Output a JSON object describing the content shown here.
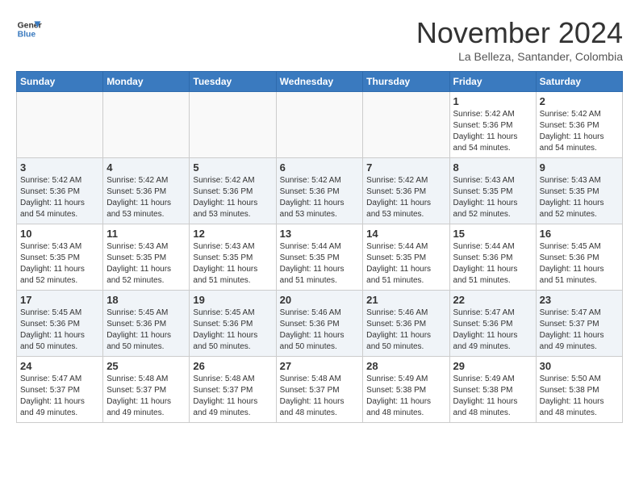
{
  "logo": {
    "line1": "General",
    "line2": "Blue"
  },
  "title": "November 2024",
  "location": "La Belleza, Santander, Colombia",
  "weekdays": [
    "Sunday",
    "Monday",
    "Tuesday",
    "Wednesday",
    "Thursday",
    "Friday",
    "Saturday"
  ],
  "weeks": [
    [
      {
        "day": "",
        "info": ""
      },
      {
        "day": "",
        "info": ""
      },
      {
        "day": "",
        "info": ""
      },
      {
        "day": "",
        "info": ""
      },
      {
        "day": "",
        "info": ""
      },
      {
        "day": "1",
        "info": "Sunrise: 5:42 AM\nSunset: 5:36 PM\nDaylight: 11 hours and 54 minutes."
      },
      {
        "day": "2",
        "info": "Sunrise: 5:42 AM\nSunset: 5:36 PM\nDaylight: 11 hours and 54 minutes."
      }
    ],
    [
      {
        "day": "3",
        "info": "Sunrise: 5:42 AM\nSunset: 5:36 PM\nDaylight: 11 hours and 54 minutes."
      },
      {
        "day": "4",
        "info": "Sunrise: 5:42 AM\nSunset: 5:36 PM\nDaylight: 11 hours and 53 minutes."
      },
      {
        "day": "5",
        "info": "Sunrise: 5:42 AM\nSunset: 5:36 PM\nDaylight: 11 hours and 53 minutes."
      },
      {
        "day": "6",
        "info": "Sunrise: 5:42 AM\nSunset: 5:36 PM\nDaylight: 11 hours and 53 minutes."
      },
      {
        "day": "7",
        "info": "Sunrise: 5:42 AM\nSunset: 5:36 PM\nDaylight: 11 hours and 53 minutes."
      },
      {
        "day": "8",
        "info": "Sunrise: 5:43 AM\nSunset: 5:35 PM\nDaylight: 11 hours and 52 minutes."
      },
      {
        "day": "9",
        "info": "Sunrise: 5:43 AM\nSunset: 5:35 PM\nDaylight: 11 hours and 52 minutes."
      }
    ],
    [
      {
        "day": "10",
        "info": "Sunrise: 5:43 AM\nSunset: 5:35 PM\nDaylight: 11 hours and 52 minutes."
      },
      {
        "day": "11",
        "info": "Sunrise: 5:43 AM\nSunset: 5:35 PM\nDaylight: 11 hours and 52 minutes."
      },
      {
        "day": "12",
        "info": "Sunrise: 5:43 AM\nSunset: 5:35 PM\nDaylight: 11 hours and 51 minutes."
      },
      {
        "day": "13",
        "info": "Sunrise: 5:44 AM\nSunset: 5:35 PM\nDaylight: 11 hours and 51 minutes."
      },
      {
        "day": "14",
        "info": "Sunrise: 5:44 AM\nSunset: 5:35 PM\nDaylight: 11 hours and 51 minutes."
      },
      {
        "day": "15",
        "info": "Sunrise: 5:44 AM\nSunset: 5:36 PM\nDaylight: 11 hours and 51 minutes."
      },
      {
        "day": "16",
        "info": "Sunrise: 5:45 AM\nSunset: 5:36 PM\nDaylight: 11 hours and 51 minutes."
      }
    ],
    [
      {
        "day": "17",
        "info": "Sunrise: 5:45 AM\nSunset: 5:36 PM\nDaylight: 11 hours and 50 minutes."
      },
      {
        "day": "18",
        "info": "Sunrise: 5:45 AM\nSunset: 5:36 PM\nDaylight: 11 hours and 50 minutes."
      },
      {
        "day": "19",
        "info": "Sunrise: 5:45 AM\nSunset: 5:36 PM\nDaylight: 11 hours and 50 minutes."
      },
      {
        "day": "20",
        "info": "Sunrise: 5:46 AM\nSunset: 5:36 PM\nDaylight: 11 hours and 50 minutes."
      },
      {
        "day": "21",
        "info": "Sunrise: 5:46 AM\nSunset: 5:36 PM\nDaylight: 11 hours and 50 minutes."
      },
      {
        "day": "22",
        "info": "Sunrise: 5:47 AM\nSunset: 5:36 PM\nDaylight: 11 hours and 49 minutes."
      },
      {
        "day": "23",
        "info": "Sunrise: 5:47 AM\nSunset: 5:37 PM\nDaylight: 11 hours and 49 minutes."
      }
    ],
    [
      {
        "day": "24",
        "info": "Sunrise: 5:47 AM\nSunset: 5:37 PM\nDaylight: 11 hours and 49 minutes."
      },
      {
        "day": "25",
        "info": "Sunrise: 5:48 AM\nSunset: 5:37 PM\nDaylight: 11 hours and 49 minutes."
      },
      {
        "day": "26",
        "info": "Sunrise: 5:48 AM\nSunset: 5:37 PM\nDaylight: 11 hours and 49 minutes."
      },
      {
        "day": "27",
        "info": "Sunrise: 5:48 AM\nSunset: 5:37 PM\nDaylight: 11 hours and 48 minutes."
      },
      {
        "day": "28",
        "info": "Sunrise: 5:49 AM\nSunset: 5:38 PM\nDaylight: 11 hours and 48 minutes."
      },
      {
        "day": "29",
        "info": "Sunrise: 5:49 AM\nSunset: 5:38 PM\nDaylight: 11 hours and 48 minutes."
      },
      {
        "day": "30",
        "info": "Sunrise: 5:50 AM\nSunset: 5:38 PM\nDaylight: 11 hours and 48 minutes."
      }
    ]
  ]
}
